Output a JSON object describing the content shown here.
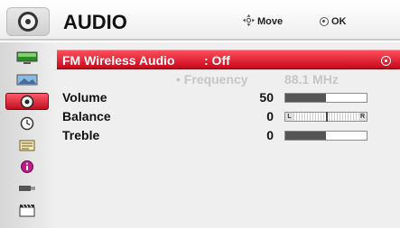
{
  "header": {
    "title": "AUDIO",
    "move_hint": "Move",
    "ok_hint": "OK",
    "icon": "speaker-icon"
  },
  "sidebar": {
    "items": [
      {
        "icon": "picture-icon"
      },
      {
        "icon": "screen-icon"
      },
      {
        "icon": "audio-icon",
        "active": true
      },
      {
        "icon": "time-icon"
      },
      {
        "icon": "option-icon"
      },
      {
        "icon": "info-icon"
      },
      {
        "icon": "usb-icon"
      },
      {
        "icon": "slideshow-icon"
      }
    ]
  },
  "audio": {
    "fm_wireless_label": "FM Wireless Audio",
    "fm_wireless_value": ": Off",
    "frequency_label": "• Frequency",
    "frequency_value": "88.1 MHz",
    "settings": [
      {
        "label": "Volume",
        "value": "50",
        "level": 0.5
      },
      {
        "label": "Balance",
        "value": "0"
      },
      {
        "label": "Treble",
        "value": "0",
        "level": 0.5
      }
    ],
    "balance_left": "L",
    "balance_right": "R"
  },
  "colors": {
    "accent": "#d61427",
    "panel": "#efefef",
    "disabled_text": "#c6c6c6"
  }
}
